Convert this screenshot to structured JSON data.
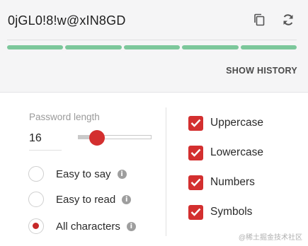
{
  "password": {
    "value": "0jGL0!8!w@xIN8GD"
  },
  "icons": {
    "copy": "copy-icon",
    "refresh": "refresh-icon",
    "info": "info-icon",
    "check": "checkmark-icon"
  },
  "strength": {
    "segments": 5,
    "filled": 5,
    "color": "#7cc79b"
  },
  "history": {
    "label": "SHOW HISTORY"
  },
  "length": {
    "label": "Password length",
    "value": "16",
    "min": 4,
    "max": 50,
    "current": 16
  },
  "modes": [
    {
      "label": "Easy to say",
      "checked": false
    },
    {
      "label": "Easy to read",
      "checked": false
    },
    {
      "label": "All characters",
      "checked": true
    }
  ],
  "options": [
    {
      "label": "Uppercase",
      "checked": true
    },
    {
      "label": "Lowercase",
      "checked": true
    },
    {
      "label": "Numbers",
      "checked": true
    },
    {
      "label": "Symbols",
      "checked": true
    }
  ],
  "watermark": "@稀土掘金技术社区",
  "colors": {
    "accent": "#d32f2f",
    "strength": "#7cc79b"
  }
}
